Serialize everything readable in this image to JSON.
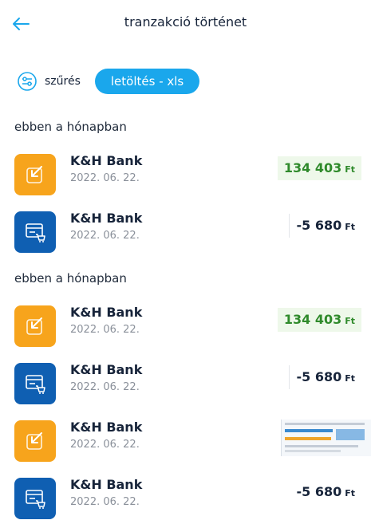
{
  "header": {
    "title": "tranzakció történet",
    "back_icon": "arrow-left-icon"
  },
  "toolbar": {
    "filter_label": "szűrés",
    "download_label": "letöltés - xls",
    "filter_icon": "sliders-icon"
  },
  "sections": [
    {
      "title": "ebben a hónapban",
      "items": [
        {
          "name": "K&H Bank",
          "date": "2022. 06. 22.",
          "amount": "134 403",
          "currency": "Ft",
          "kind": "income",
          "icon": "arrow-in-icon"
        },
        {
          "name": "K&H Bank",
          "date": "2022. 06. 22.",
          "amount": "-5 680",
          "currency": "Ft",
          "kind": "expense",
          "icon": "card-cart-icon"
        }
      ]
    },
    {
      "title": "ebben a hónapban",
      "items": [
        {
          "name": "K&H Bank",
          "date": "2022. 06. 22.",
          "amount": "134 403",
          "currency": "Ft",
          "kind": "income",
          "icon": "arrow-in-icon"
        },
        {
          "name": "K&H Bank",
          "date": "2022. 06. 22.",
          "amount": "-5 680",
          "currency": "Ft",
          "kind": "expense",
          "icon": "card-cart-icon"
        },
        {
          "name": "K&H Bank",
          "date": "2022. 06. 22.",
          "amount": "",
          "currency": "",
          "kind": "thumbnail",
          "icon": "arrow-in-icon"
        },
        {
          "name": "K&H Bank",
          "date": "2022. 06. 22.",
          "amount": "-5 680",
          "currency": "Ft",
          "kind": "expense",
          "icon": "card-cart-icon"
        }
      ]
    }
  ],
  "colors": {
    "accent": "#1aa7ec",
    "income_tile": "#f7a41c",
    "expense_tile": "#0f5fb2",
    "income_text": "#2f8a2b"
  }
}
